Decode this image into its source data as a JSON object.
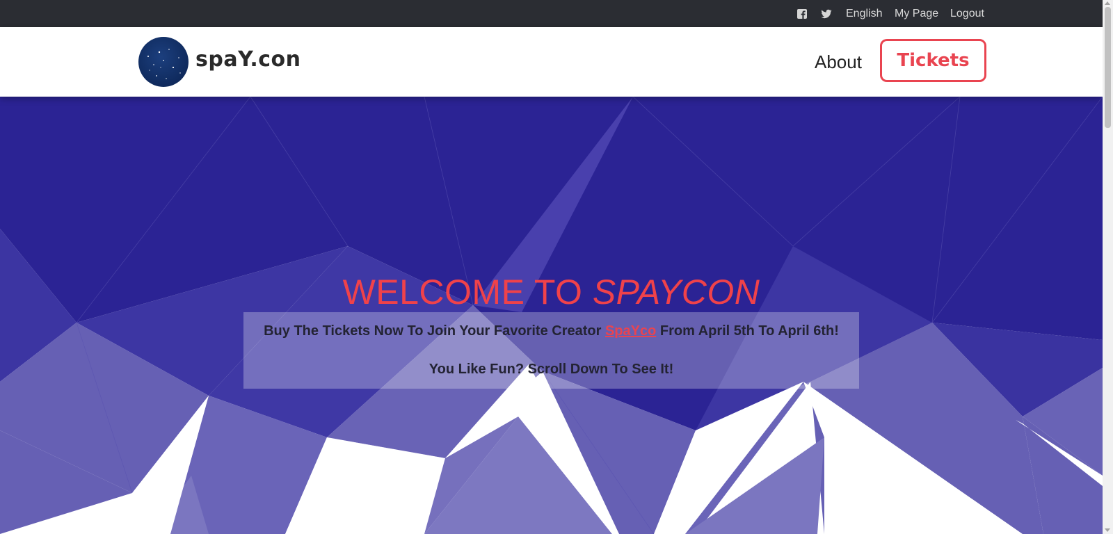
{
  "topbar": {
    "icons": [
      "facebook-icon",
      "twitter-icon"
    ],
    "language": "English",
    "my_page": "My Page",
    "logout": "Logout"
  },
  "header": {
    "logo_text": "spaY.con",
    "nav": {
      "about": "About",
      "tickets": "Tickets"
    }
  },
  "hero": {
    "title_prefix": "WELCOME TO ",
    "title_name": "SPAYCON",
    "line1_before": "Buy The Tickets Now To Join Your Favorite Creator ",
    "line1_link": "SpaYco",
    "line1_after": " From April 5th To April 6th!",
    "line2": "You Like Fun? Scroll Down To See It!"
  },
  "colors": {
    "accent": "#e94450",
    "topbar_bg": "#2b2d33",
    "hero_dark": "#2b2394",
    "hero_mid": "#3d36a3",
    "hero_light": "#6660b4"
  }
}
